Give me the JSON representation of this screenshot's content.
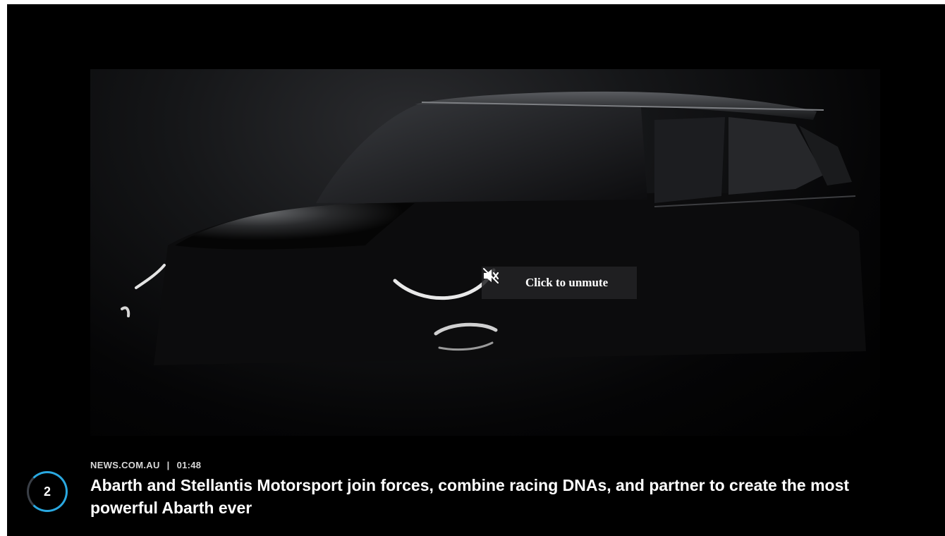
{
  "player": {
    "unmute_label": "Click to unmute",
    "unmute_icon": "speaker-muted-icon"
  },
  "caption": {
    "position_number": "2",
    "source": "NEWS.COM.AU",
    "separator": "|",
    "duration": "01:48",
    "headline": "Abarth and Stellantis Motorsport join forces, combine racing DNAs, and partner to create the most powerful Abarth ever"
  },
  "colors": {
    "background": "#000000",
    "accent": "#2aa8e0",
    "text": "#ffffff"
  }
}
